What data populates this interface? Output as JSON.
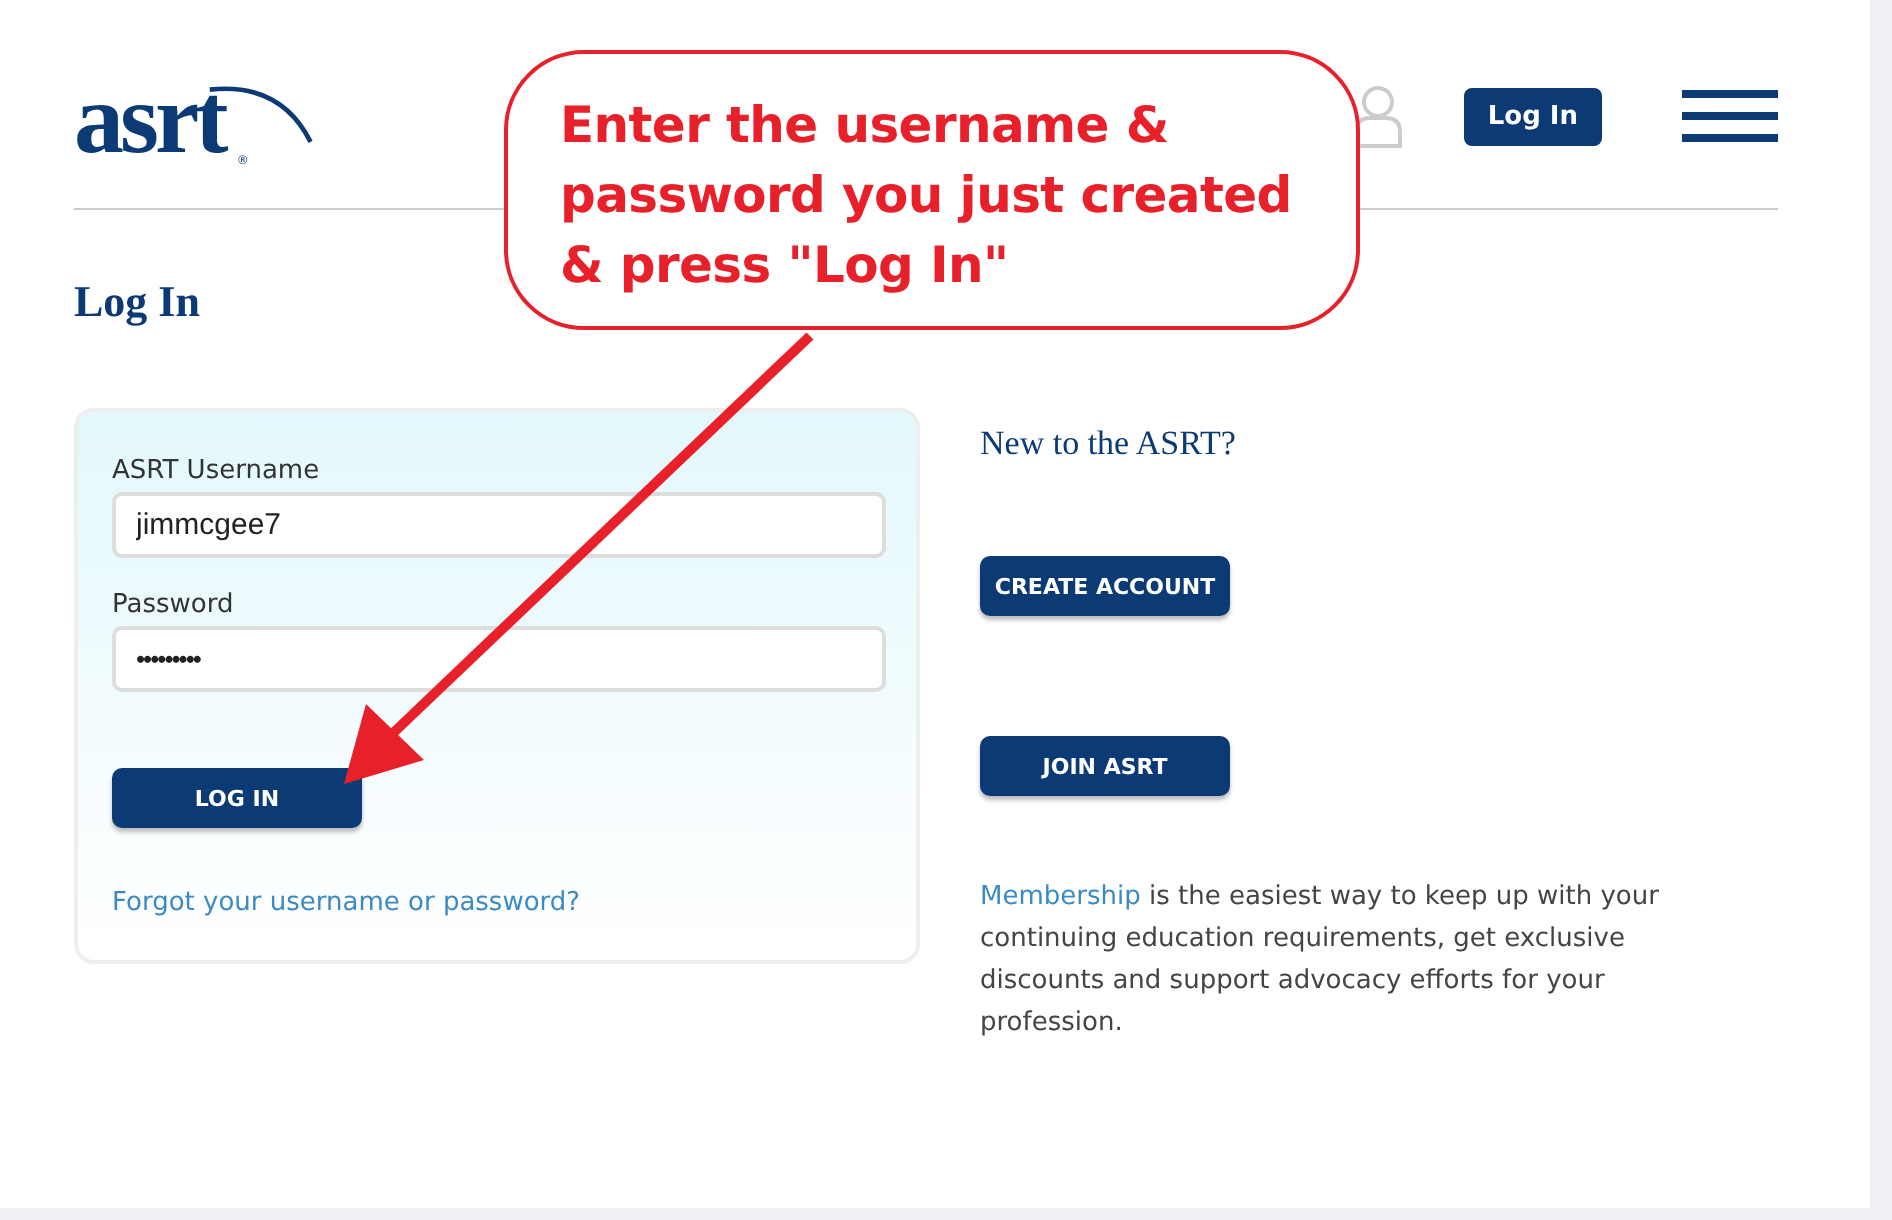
{
  "header": {
    "logo": "asrt",
    "logo_mark": "®",
    "login_button": "Log In"
  },
  "page_title": "Log In",
  "login_form": {
    "username_label": "ASRT Username",
    "username_value": "jimmcgee7",
    "password_label": "Password",
    "password_value": "•••••••••",
    "submit": "LOG IN",
    "forgot_link": "Forgot your username or password?"
  },
  "signup": {
    "heading": "New to the ASRT?",
    "buttons": [
      "CREATE ACCOUNT",
      "JOIN ASRT"
    ],
    "link": "Membership",
    "text": " is the easiest way to keep up with your continuing education requirements, get exclusive discounts and support advocacy efforts for your profession."
  },
  "callout": {
    "lines": [
      "Enter the username &",
      "password you just created",
      "& press \"Log In\""
    ]
  }
}
